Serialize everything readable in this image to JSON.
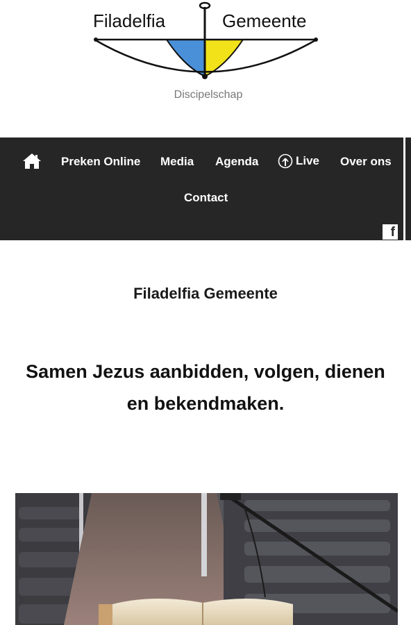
{
  "logo": {
    "left_word": "Filadelfia",
    "right_word": "Gemeente",
    "tagline": "Discipelschap",
    "colors": {
      "blue": "#4a90d9",
      "yellow": "#f2e21a"
    }
  },
  "nav": {
    "home_icon": "home-icon",
    "items": [
      {
        "label": "Preken Online"
      },
      {
        "label": "Media"
      },
      {
        "label": "Agenda"
      },
      {
        "label": "Live",
        "icon": "podcast-icon"
      },
      {
        "label": "Over ons"
      },
      {
        "label": "Contact"
      }
    ],
    "social_icon": "facebook-icon",
    "social_glyph": "f",
    "background": "#262626"
  },
  "content": {
    "title": "Filadelfia Gemeente",
    "slogan": "Samen Jezus aanbidden, volgen, dienen en bekendmaken."
  },
  "hero": {
    "description_icon": "church-pulpit-bible-photo"
  }
}
